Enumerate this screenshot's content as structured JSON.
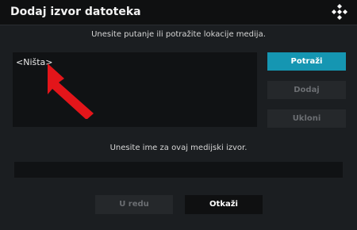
{
  "window": {
    "title": "Dodaj izvor datoteka",
    "logo_icon": "kodi-logo-icon"
  },
  "instructions": {
    "top": "Unesite putanje ili potražite lokacije medija.",
    "name_prompt": "Unesite ime za ovaj medijski izvor."
  },
  "path_list": {
    "items": [
      "<Ništa>"
    ]
  },
  "side_buttons": {
    "browse_label": "Potraži",
    "add_label": "Dodaj",
    "remove_label": "Ukloni"
  },
  "name_field": {
    "value": ""
  },
  "bottom_buttons": {
    "ok_label": "U redu",
    "cancel_label": "Otkaži"
  },
  "annotation": {
    "arrow_icon": "red-arrow-icon",
    "color": "#e3151a"
  },
  "colors": {
    "accent": "#1596b2",
    "background": "#1b1e21",
    "titlebar": "#0f1011"
  }
}
